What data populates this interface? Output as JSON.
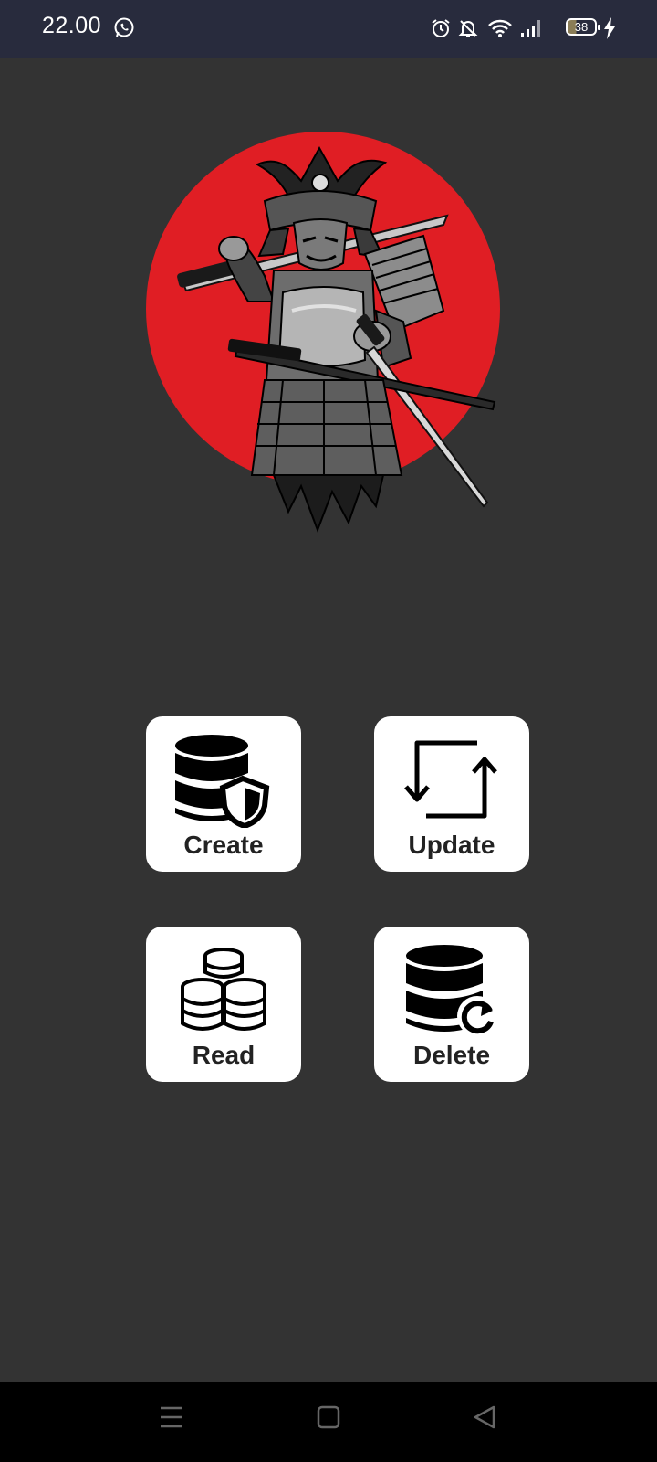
{
  "status_bar": {
    "time": "22.00",
    "battery_level": "38",
    "icons": [
      "whatsapp-icon",
      "alarm-icon",
      "notifications-muted-icon",
      "wifi-icon",
      "signal-icon",
      "battery-icon",
      "charging-icon"
    ]
  },
  "hero": {
    "image": "samurai-warrior-red-sun-illustration"
  },
  "actions": {
    "create": {
      "label": "Create",
      "icon": "database-shield-icon"
    },
    "update": {
      "label": "Update",
      "icon": "sync-arrows-icon"
    },
    "read": {
      "label": "Read",
      "icon": "stacked-databases-icon"
    },
    "delete": {
      "label": "Delete",
      "icon": "database-refresh-icon"
    }
  },
  "navigation": {
    "buttons": [
      "menu-icon",
      "home-icon",
      "back-icon"
    ]
  },
  "colors": {
    "background": "#333333",
    "status_bar": "#282b3d",
    "accent_red": "#e01e24",
    "tile": "#ffffff"
  }
}
